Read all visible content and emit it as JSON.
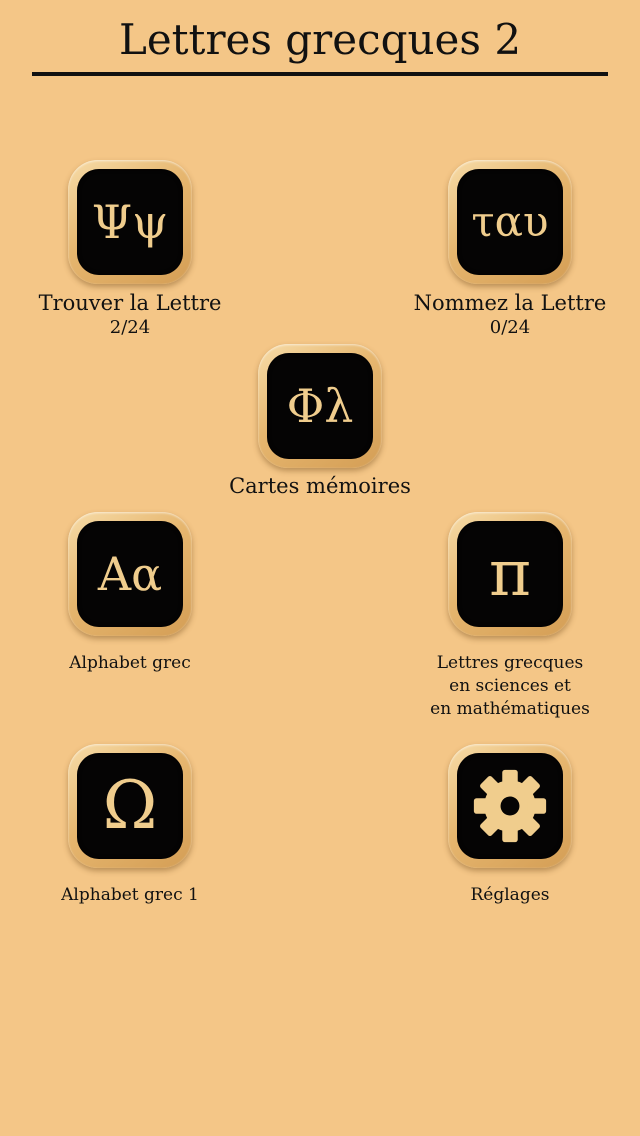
{
  "header": {
    "title": "Lettres grecques 2"
  },
  "menu": {
    "find_letter": {
      "icon": "ΨΨ",
      "icon_text": "Ψψ",
      "label": "Trouver la Lettre",
      "count": "2/24"
    },
    "name_letter": {
      "icon_text": "ταυ",
      "label": "Nommez la Lettre",
      "count": "0/24"
    },
    "flashcards": {
      "icon_text": "Φλ",
      "label": "Cartes mémoires"
    },
    "alphabet": {
      "icon_text": "Αα",
      "label": "Alphabet grec"
    },
    "sciences": {
      "icon_text": "π",
      "label_line1": "Lettres grecques",
      "label_line2": "en sciences et",
      "label_line3": "en mathématiques"
    },
    "alphabet1": {
      "icon_text": "Ω",
      "label": "Alphabet grec 1"
    },
    "settings": {
      "icon": "gear-icon",
      "label": "Réglages"
    }
  },
  "colors": {
    "background": "#f4c687",
    "tile_face": "#050404",
    "glyph": "#f0cd8d",
    "text": "#111111"
  }
}
